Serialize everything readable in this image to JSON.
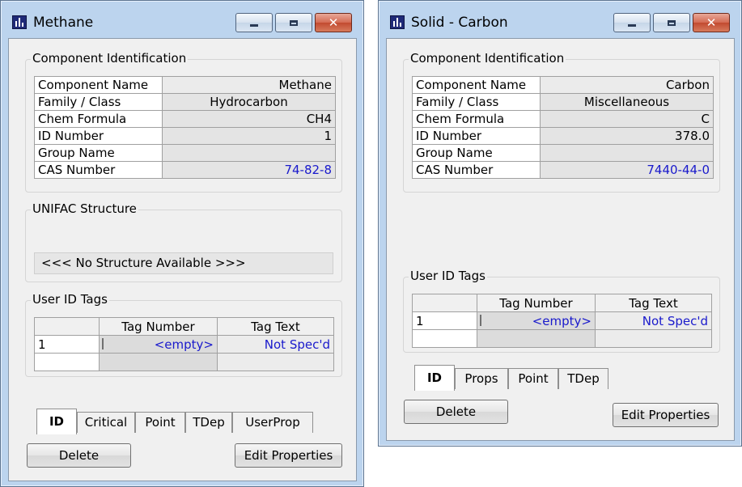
{
  "methane": {
    "title": "Methane",
    "component_group_label": "Component Identification",
    "fields": [
      {
        "label": "Component Name",
        "value": "Methane"
      },
      {
        "label": "Family / Class",
        "value": "Hydrocarbon"
      },
      {
        "label": "Chem Formula",
        "value": "CH4"
      },
      {
        "label": "ID Number",
        "value": "1"
      },
      {
        "label": "Group Name",
        "value": ""
      },
      {
        "label": "CAS Number",
        "value": "74-82-8"
      }
    ],
    "unifac_label": "UNIFAC Structure",
    "unifac_message": "<<< No Structure Available >>>",
    "tags_label": "User ID Tags",
    "tags_headers": {
      "col1": "Tag Number",
      "col2": "Tag Text"
    },
    "tags_row": {
      "num": "1",
      "tag_number": "<empty>",
      "tag_text": "Not Spec'd"
    },
    "tabs": [
      "ID",
      "Critical",
      "Point",
      "TDep",
      "UserProp"
    ],
    "delete_label": "Delete",
    "edit_label": "Edit Properties"
  },
  "carbon": {
    "title": "Solid - Carbon",
    "component_group_label": "Component Identification",
    "fields": [
      {
        "label": "Component Name",
        "value": "Carbon"
      },
      {
        "label": "Family / Class",
        "value": "Miscellaneous"
      },
      {
        "label": "Chem Formula",
        "value": "C"
      },
      {
        "label": "ID Number",
        "value": "378.0"
      },
      {
        "label": "Group Name",
        "value": ""
      },
      {
        "label": "CAS Number",
        "value": "7440-44-0"
      }
    ],
    "tags_label": "User ID Tags",
    "tags_headers": {
      "col1": "Tag Number",
      "col2": "Tag Text"
    },
    "tags_row": {
      "num": "1",
      "tag_number": "<empty>",
      "tag_text": "Not Spec'd"
    },
    "tabs": [
      "ID",
      "Props",
      "Point",
      "TDep"
    ],
    "delete_label": "Delete",
    "edit_label": "Edit Properties"
  },
  "colors": {
    "frame": "#bcd4ee",
    "client": "#f0f0f0",
    "link_blue": "#1a1acc",
    "close_button": "#c24a30"
  }
}
